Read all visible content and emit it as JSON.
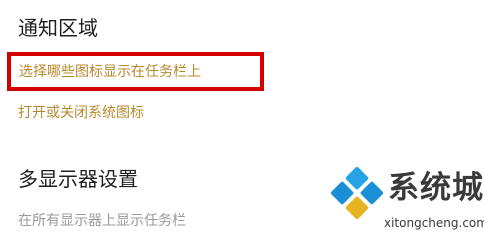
{
  "notification_area": {
    "title": "通知区域",
    "link_select_taskbar_icons": "选择哪些图标显示在任务栏上",
    "link_toggle_system_icons": "打开或关闭系统图标"
  },
  "multiple_displays": {
    "title": "多显示器设置",
    "show_taskbar_all_displays": "在所有显示器上显示任务栏"
  },
  "watermark": {
    "brand": "系统城",
    "site": "xitongcheng.com"
  },
  "colors": {
    "link": "#b58a2e",
    "muted_text": "#9a9a9a",
    "heading": "#1f1f1f",
    "highlight": "#d40000",
    "logo_blue": "#1a8fd6"
  }
}
